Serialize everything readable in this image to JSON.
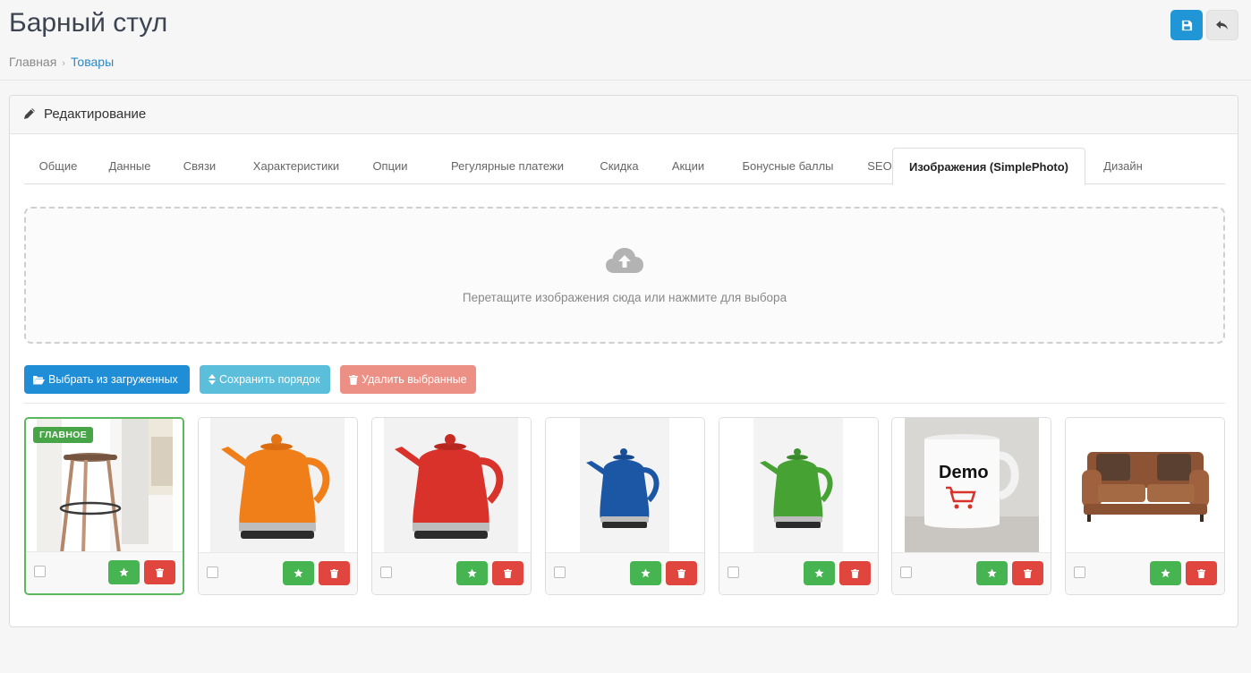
{
  "header": {
    "title": "Барный стул",
    "breadcrumb": {
      "home": "Главная",
      "current": "Товары"
    }
  },
  "panel": {
    "title": "Редактирование"
  },
  "tabs": [
    {
      "label": "Общие",
      "active": false
    },
    {
      "label": "Данные",
      "active": false
    },
    {
      "label": "Связи",
      "active": false
    },
    {
      "label": "Характеристики",
      "active": false
    },
    {
      "label": "Опции",
      "active": false
    },
    {
      "label": "Регулярные платежи",
      "active": false
    },
    {
      "label": "Скидка",
      "active": false
    },
    {
      "label": "Акции",
      "active": false
    },
    {
      "label": "Бонусные баллы",
      "active": false
    },
    {
      "label": "SEO",
      "active": false
    },
    {
      "label": "Изображения (SimplePhoto)",
      "active": true
    },
    {
      "label": "Дизайн",
      "active": false
    }
  ],
  "dropzone": {
    "text": "Перетащите изображения сюда или нажмите для выбора",
    "icon": "cloud-upload-icon"
  },
  "actions": {
    "choose_uploaded": "Выбрать из загруженных",
    "save_order": "Сохранить порядок",
    "delete_selected": "Удалить выбранные"
  },
  "images": [
    {
      "subject": "bar-stool",
      "main": true,
      "badge": "ГЛАВНОЕ"
    },
    {
      "subject": "kettle",
      "color": "#f07f1a",
      "main": false
    },
    {
      "subject": "kettle",
      "color": "#d9322a",
      "main": false
    },
    {
      "subject": "kettle",
      "color": "#1c57a6",
      "main": false
    },
    {
      "subject": "kettle",
      "color": "#45a233",
      "main": false
    },
    {
      "subject": "mug",
      "text": "Demo",
      "main": false
    },
    {
      "subject": "sofa",
      "color": "#9a5c3a",
      "main": false
    }
  ],
  "colors": {
    "primary": "#1f8ed6",
    "info": "#5bbfdc",
    "danger_light": "#ec9085",
    "success": "#46b451",
    "danger": "#e0463d",
    "link": "#2a8ac9"
  }
}
